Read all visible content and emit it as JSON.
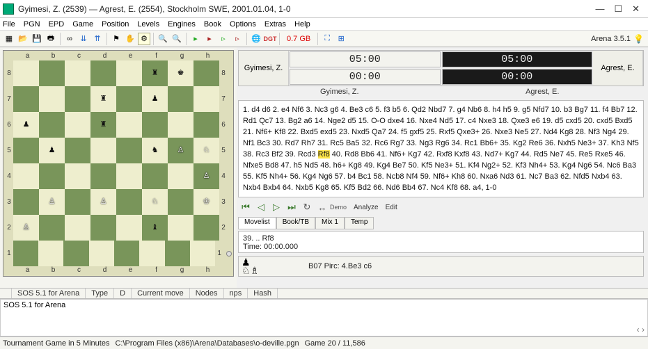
{
  "window": {
    "title": "Gyimesi, Z. (2539) — Agrest, E. (2554),  Stockholm SWE,  2001.01.04,  1-0",
    "min": "—",
    "max": "☐",
    "close": "✕",
    "brand": "Arena 3.5.1"
  },
  "menu": [
    "File",
    "PGN",
    "EPD",
    "Game",
    "Position",
    "Levels",
    "Engines",
    "Book",
    "Options",
    "Extras",
    "Help"
  ],
  "toolbar": {
    "gb": "0.7 GB"
  },
  "board": {
    "files": [
      "a",
      "b",
      "c",
      "d",
      "e",
      "f",
      "g",
      "h"
    ],
    "ranks": [
      "8",
      "7",
      "6",
      "5",
      "4",
      "3",
      "2",
      "1"
    ],
    "pieces": {
      "f8": "br",
      "g8": "bk",
      "d7": "br",
      "f7": "bp",
      "a6": "bp",
      "d6": "br",
      "b5": "bp",
      "f5": "bn",
      "g5": "wp",
      "h5": "wn",
      "h4": "wp",
      "b3": "wp",
      "d3": "wp",
      "f3": "wn",
      "h3": "wk",
      "a2": "wp",
      "f2": "bb",
      "no": "x"
    }
  },
  "clocks": {
    "white_name": "Gyimesi, Z.",
    "black_name": "Agrest, E.",
    "white_main": "05:00",
    "white_sub": "00:00",
    "black_main": "05:00",
    "black_sub": "00:00"
  },
  "moves_pre": "1. d4 d6 2. e4 Nf6 3. Nc3 g6 4. Be3 c6 5. f3 b5 6. Qd2 Nbd7 7. g4 Nb6 8. h4 h5 9. g5 Nfd7 10. b3 Bg7 11. f4 Bb7 12. Rd1 Qc7 13. Bg2 a6 14. Nge2 d5 15. O-O dxe4 16. Nxe4 Nd5 17. c4 Nxe3 18. Qxe3 e6 19. d5 cxd5 20. cxd5 Bxd5 21. Nf6+ Kf8 22. Bxd5 exd5 23. Nxd5 Qa7 24. f5 gxf5 25. Rxf5 Qxe3+ 26. Nxe3 Ne5 27. Nd4 Kg8 28. Nf3 Ng4 29. Nf1 Bc3 30. Rd7 Rh7 31. Rc5 Ba5 32. Rc6 Rg7 33. Ng3 Rg6 34. Rc1 Bb6+ 35. Kg2 Re6 36. Nxh5 Ne3+ 37. Kh3 Nf5 38. Rc3 Bf2 39. Rcd3 ",
  "moves_hl": "Rf8",
  "moves_post": " 40. Rd8 Bb6 41. Nf6+ Kg7 42. Rxf8 Kxf8 43. Nd7+ Kg7 44. Rd5 Ne7 45. Re5 Rxe5 46. Nfxe5 Bd8 47. h5 Nd5 48. h6+ Kg8 49. Kg4 Be7 50. Kf5 Ne3+ 51. Kf4 Ng2+ 52. Kf3 Nh4+ 53. Kg4 Ng6 54. Nc6 Ba3 55. Kf5 Nh4+ 56. Kg4 Ng6 57. b4 Bc1 58. Ncb8 Nf4 59. Nf6+ Kh8 60. Nxa6 Nd3 61. Nc7 Ba3 62. Nfd5 Nxb4 63. Nxb4 Bxb4 64. Nxb5 Kg8 65. Kf5 Bd2 66. Nd6 Bb4 67. Nc4 Kf8 68. a4, 1-0",
  "nav": {
    "analyze": "Analyze",
    "edit": "Edit",
    "demo": "Demo"
  },
  "tabs": [
    "Movelist",
    "Book/TB",
    "Mix 1",
    "Temp"
  ],
  "info": {
    "line1": "39. .. Rf8",
    "line2": "Time: 00:00.000"
  },
  "eco": {
    "glyphs": "♟\n♘♗",
    "text": "B07  Pirc: 4.Be3 c6"
  },
  "status": {
    "sos": "SOS 5.1 for Arena",
    "type": "Type",
    "d": "D",
    "cur": "Current move",
    "nodes": "Nodes",
    "nps": "nps",
    "hash": "Hash"
  },
  "engine_line": "SOS 5.1 for Arena",
  "footer": {
    "l": "Tournament Game in 5 Minutes",
    "m": "C:\\Program Files (x86)\\Arena\\Databases\\o-deville.pgn",
    "r": "Game 20 / 11,586"
  }
}
